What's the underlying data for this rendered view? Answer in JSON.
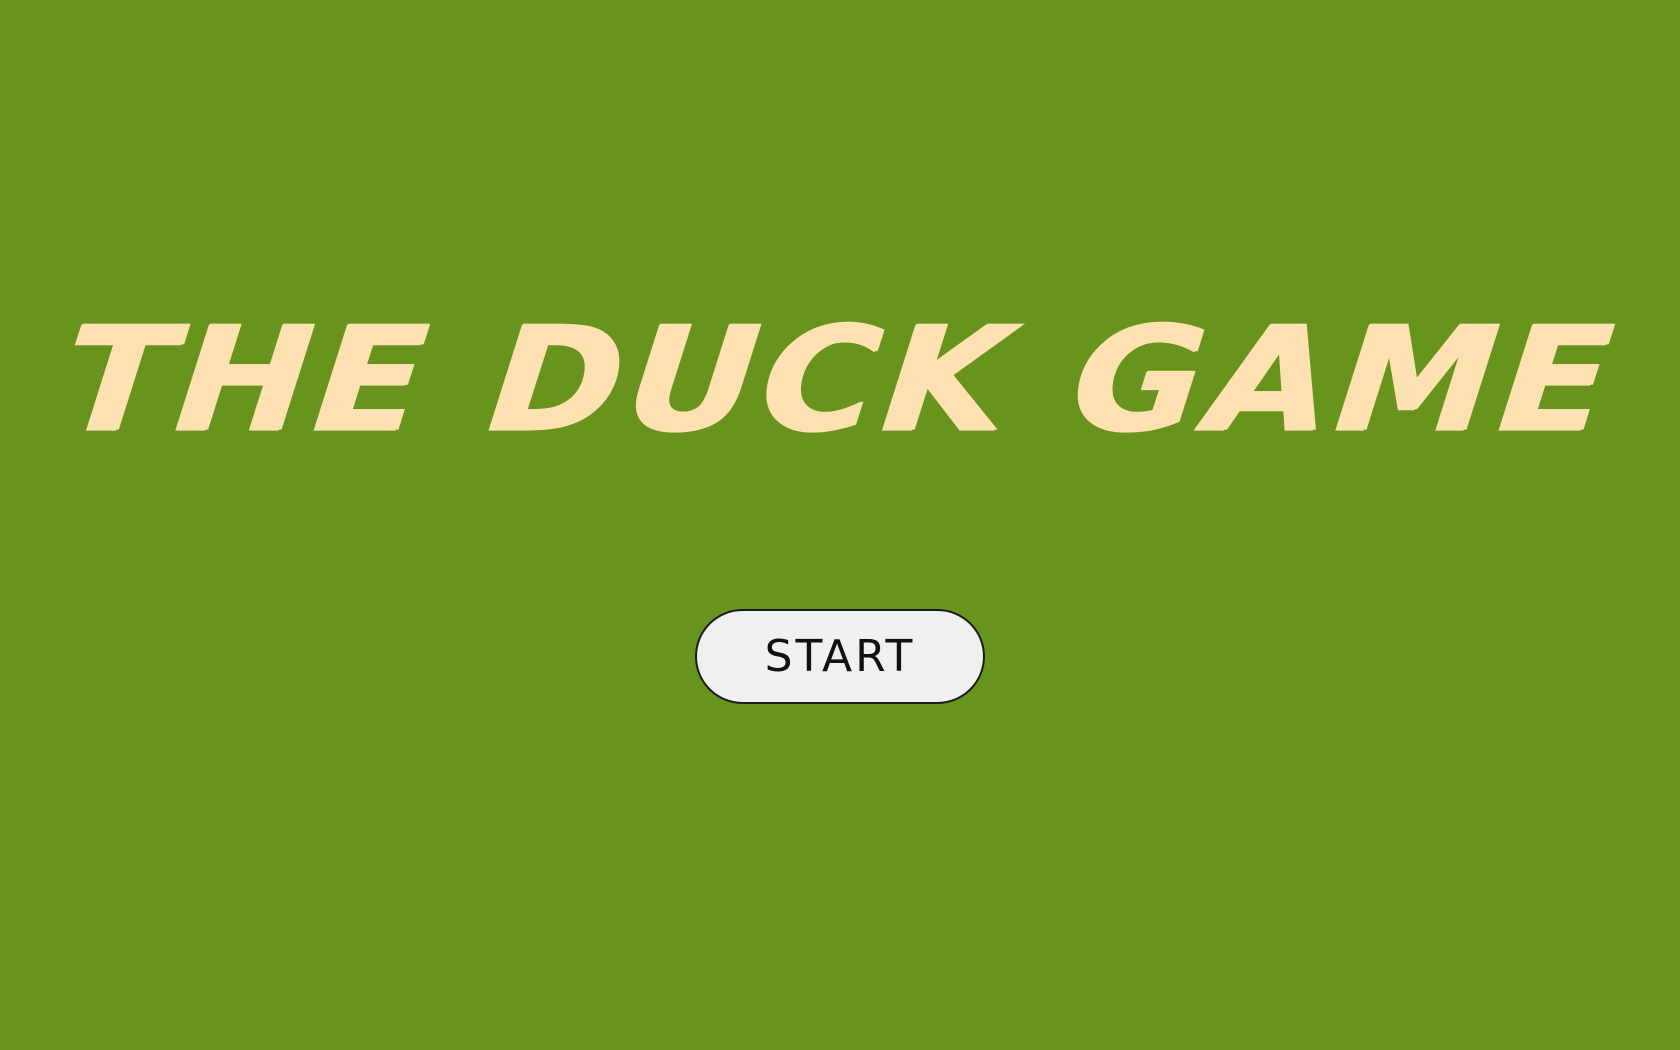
{
  "title": {
    "text": "THE DUCK GAME",
    "color": "#fde1b0"
  },
  "start_button": {
    "label": "START"
  },
  "colors": {
    "background": "#68941d",
    "button_background": "#f0f0f0",
    "button_border": "#1c1c1c",
    "button_text": "#111111"
  }
}
